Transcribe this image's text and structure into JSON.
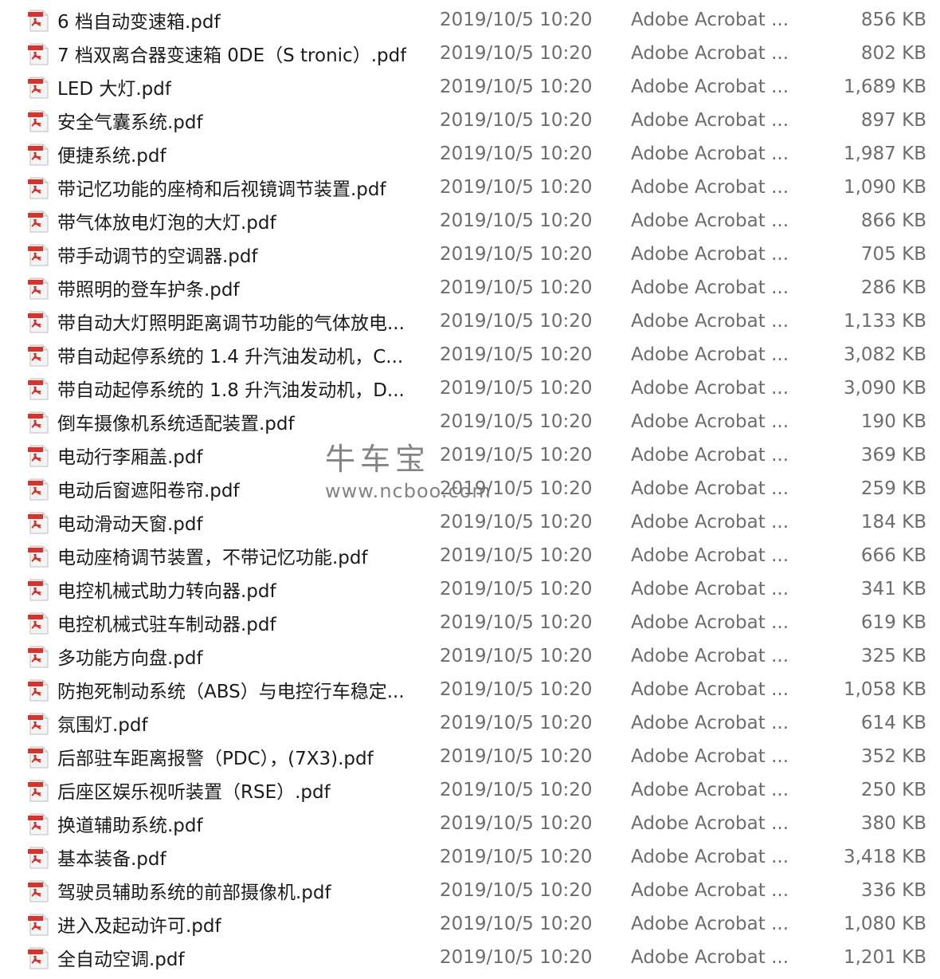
{
  "icon": "pdf-file-icon",
  "accent_color": "#d9322b",
  "files": [
    {
      "name": "6 档自动变速箱.pdf",
      "date": "2019/10/5 10:20",
      "type": "Adobe Acrobat ...",
      "size": "856 KB"
    },
    {
      "name": "7 档双离合器变速箱 0DE（S tronic）.pdf",
      "date": "2019/10/5 10:20",
      "type": "Adobe Acrobat ...",
      "size": "802 KB"
    },
    {
      "name": "LED 大灯.pdf",
      "date": "2019/10/5 10:20",
      "type": "Adobe Acrobat ...",
      "size": "1,689 KB"
    },
    {
      "name": "安全气囊系统.pdf",
      "date": "2019/10/5 10:20",
      "type": "Adobe Acrobat ...",
      "size": "897 KB"
    },
    {
      "name": "便捷系统.pdf",
      "date": "2019/10/5 10:20",
      "type": "Adobe Acrobat ...",
      "size": "1,987 KB"
    },
    {
      "name": "带记忆功能的座椅和后视镜调节装置.pdf",
      "date": "2019/10/5 10:20",
      "type": "Adobe Acrobat ...",
      "size": "1,090 KB"
    },
    {
      "name": "带气体放电灯泡的大灯.pdf",
      "date": "2019/10/5 10:20",
      "type": "Adobe Acrobat ...",
      "size": "866 KB"
    },
    {
      "name": "带手动调节的空调器.pdf",
      "date": "2019/10/5 10:20",
      "type": "Adobe Acrobat ...",
      "size": "705 KB"
    },
    {
      "name": "带照明的登车护条.pdf",
      "date": "2019/10/5 10:20",
      "type": "Adobe Acrobat ...",
      "size": "286 KB"
    },
    {
      "name": "带自动大灯照明距离调节功能的气体放电...",
      "date": "2019/10/5 10:20",
      "type": "Adobe Acrobat ...",
      "size": "1,133 KB"
    },
    {
      "name": "带自动起停系统的 1.4 升汽油发动机，C...",
      "date": "2019/10/5 10:20",
      "type": "Adobe Acrobat ...",
      "size": "3,082 KB"
    },
    {
      "name": "带自动起停系统的 1.8 升汽油发动机，D...",
      "date": "2019/10/5 10:20",
      "type": "Adobe Acrobat ...",
      "size": "3,090 KB"
    },
    {
      "name": "倒车摄像机系统适配装置.pdf",
      "date": "2019/10/5 10:20",
      "type": "Adobe Acrobat ...",
      "size": "190 KB"
    },
    {
      "name": "电动行李厢盖.pdf",
      "date": "2019/10/5 10:20",
      "type": "Adobe Acrobat ...",
      "size": "369 KB"
    },
    {
      "name": "电动后窗遮阳卷帘.pdf",
      "date": "2019/10/5 10:20",
      "type": "Adobe Acrobat ...",
      "size": "259 KB"
    },
    {
      "name": "电动滑动天窗.pdf",
      "date": "2019/10/5 10:20",
      "type": "Adobe Acrobat ...",
      "size": "184 KB"
    },
    {
      "name": "电动座椅调节装置，不带记忆功能.pdf",
      "date": "2019/10/5 10:20",
      "type": "Adobe Acrobat ...",
      "size": "666 KB"
    },
    {
      "name": "电控机械式助力转向器.pdf",
      "date": "2019/10/5 10:20",
      "type": "Adobe Acrobat ...",
      "size": "341 KB"
    },
    {
      "name": "电控机械式驻车制动器.pdf",
      "date": "2019/10/5 10:20",
      "type": "Adobe Acrobat ...",
      "size": "619 KB"
    },
    {
      "name": "多功能方向盘.pdf",
      "date": "2019/10/5 10:20",
      "type": "Adobe Acrobat ...",
      "size": "325 KB"
    },
    {
      "name": "防抱死制动系统（ABS）与电控行车稳定...",
      "date": "2019/10/5 10:20",
      "type": "Adobe Acrobat ...",
      "size": "1,058 KB"
    },
    {
      "name": "氛围灯.pdf",
      "date": "2019/10/5 10:20",
      "type": "Adobe Acrobat ...",
      "size": "614 KB"
    },
    {
      "name": "后部驻车距离报警（PDC），(7X3).pdf",
      "date": "2019/10/5 10:20",
      "type": "Adobe Acrobat ...",
      "size": "352 KB"
    },
    {
      "name": "后座区娱乐视听装置（RSE）.pdf",
      "date": "2019/10/5 10:20",
      "type": "Adobe Acrobat ...",
      "size": "250 KB"
    },
    {
      "name": "换道辅助系统.pdf",
      "date": "2019/10/5 10:20",
      "type": "Adobe Acrobat ...",
      "size": "380 KB"
    },
    {
      "name": "基本装备.pdf",
      "date": "2019/10/5 10:20",
      "type": "Adobe Acrobat ...",
      "size": "3,418 KB"
    },
    {
      "name": "驾驶员辅助系统的前部摄像机.pdf",
      "date": "2019/10/5 10:20",
      "type": "Adobe Acrobat ...",
      "size": "336 KB"
    },
    {
      "name": "进入及起动许可.pdf",
      "date": "2019/10/5 10:20",
      "type": "Adobe Acrobat ...",
      "size": "1,080 KB"
    },
    {
      "name": "全自动空调.pdf",
      "date": "2019/10/5 10:20",
      "type": "Adobe Acrobat ...",
      "size": "1,201 KB"
    }
  ],
  "watermark": {
    "title": "牛车宝",
    "url": "www.ncboo.com"
  }
}
